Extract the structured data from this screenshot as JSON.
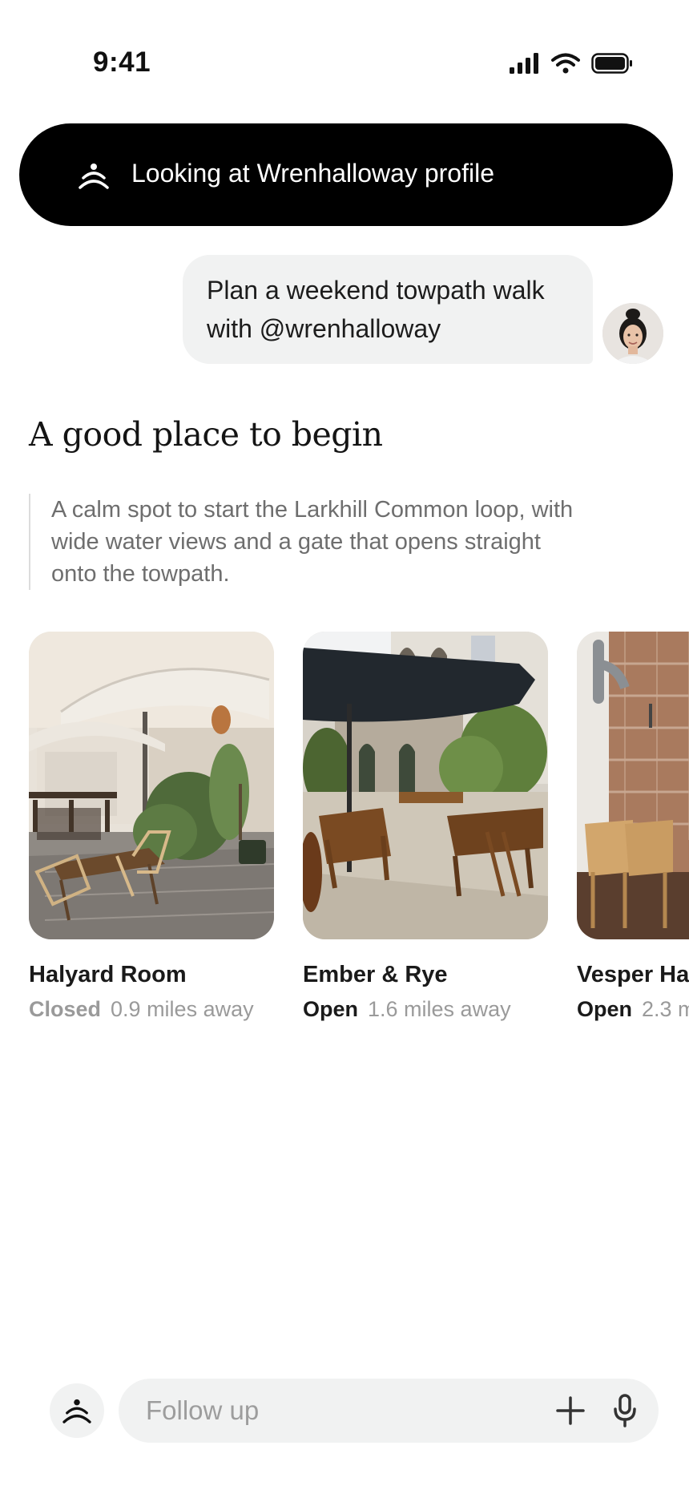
{
  "status_bar": {
    "time": "9:41",
    "icons": [
      "cellular-signal-icon",
      "wifi-icon",
      "battery-icon"
    ]
  },
  "context": {
    "icon": "assistant-icon",
    "text": "Looking at Wrenhalloway profile"
  },
  "user_message": {
    "text": "Plan a weekend towpath walk with @wrenhalloway",
    "avatar": "user-avatar"
  },
  "section": {
    "title": "A good place to begin",
    "description": "A calm spot to start the Larkhill Common loop, with wide water views and a gate that opens straight onto the towpath."
  },
  "places": [
    {
      "name": "Halyard Room",
      "status": "Closed",
      "distance": "0.9 miles away"
    },
    {
      "name": "Ember & Rye",
      "status": "Open",
      "distance": "1.6 miles away"
    },
    {
      "name": "Vesper Ha",
      "status": "Open",
      "distance": "2.3 m"
    }
  ],
  "composer": {
    "placeholder": "Follow up",
    "add_icon": "plus-icon",
    "mic_icon": "microphone-icon"
  },
  "colors": {
    "pill_background": "#000000",
    "bubble_background": "#f1f2f2",
    "muted_text": "#9a9a9a"
  }
}
